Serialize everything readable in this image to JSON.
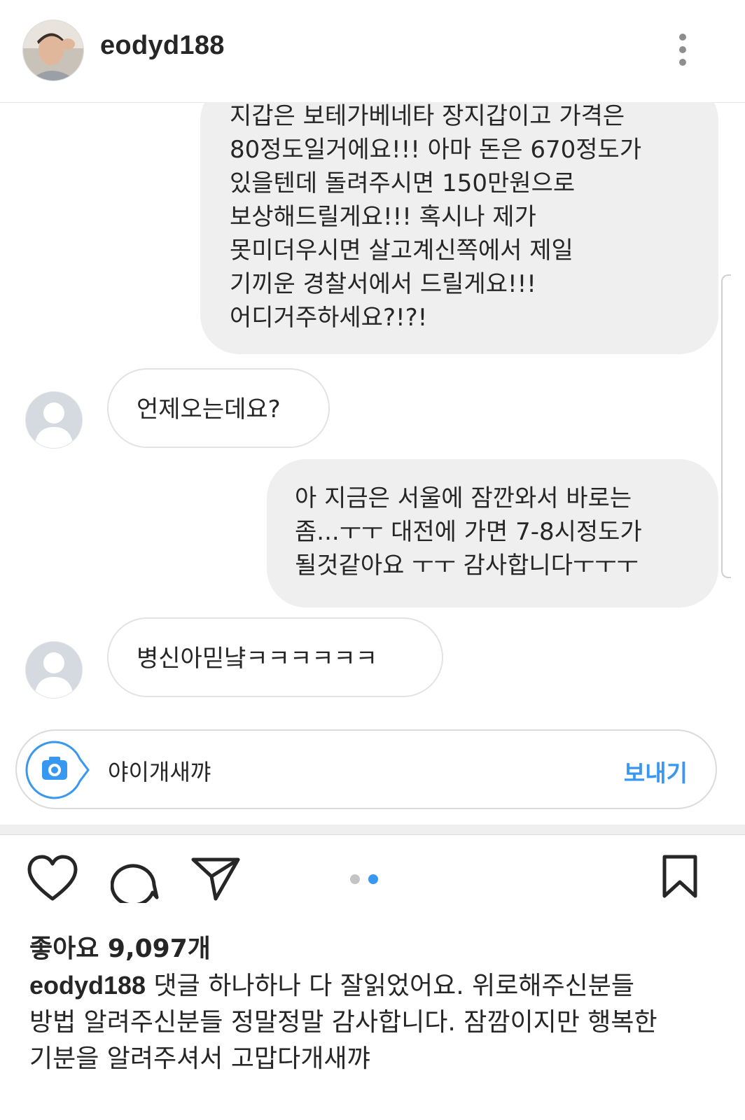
{
  "header": {
    "username": "eodyd188"
  },
  "messages": [
    {
      "sender": "me",
      "lines": [
        "지갑은 보테가베네타 장지갑이고 가격은",
        "80정도일거에요!!! 아마 돈은 670정도가",
        "있을텐데 돌려주시면 150만원으로",
        "보상해드릴게요!!! 혹시나 제가",
        "못미더우시면 살고계신쪽에서 제일",
        "기끼운 경찰서에서 드릴게요!!!",
        "어디거주하세요?!?!"
      ]
    },
    {
      "sender": "other",
      "lines": [
        "언제오는데요?"
      ]
    },
    {
      "sender": "me",
      "lines": [
        "아 지금은 서울에 잠깐와서 바로는",
        "좀...ㅜㅜ 대전에 가면 7-8시정도가",
        "될것같아요 ㅜㅜ 감사합니다ㅜㅜㅜ"
      ]
    },
    {
      "sender": "other",
      "lines": [
        "병신아믿냨ㅋㅋㅋㅋㅋㅋ"
      ]
    }
  ],
  "composer": {
    "text": "야이개새꺄",
    "send_label": "보내기"
  },
  "post": {
    "likes": "좋아요 9,097개",
    "caption_user": "eodyd188",
    "caption_lines": [
      " 댓글 하나하나 다 잘읽었어요. 위로해주신분들",
      "방법 알려주신분들 정말정말 감사합니다. 잠깜이지만 행복한",
      "기분을 알려주셔서 고맙다개새꺄"
    ],
    "carousel": {
      "count": 2,
      "active": 2
    }
  },
  "colors": {
    "accent": "#3897f0",
    "my_bubble": "#efefef",
    "text": "#262626",
    "muted_icon": "#8e8e8e"
  },
  "icons": [
    "more-vertical-icon",
    "camera-icon",
    "heart-icon",
    "comment-icon",
    "share-icon",
    "bookmark-icon",
    "default-avatar-icon"
  ]
}
